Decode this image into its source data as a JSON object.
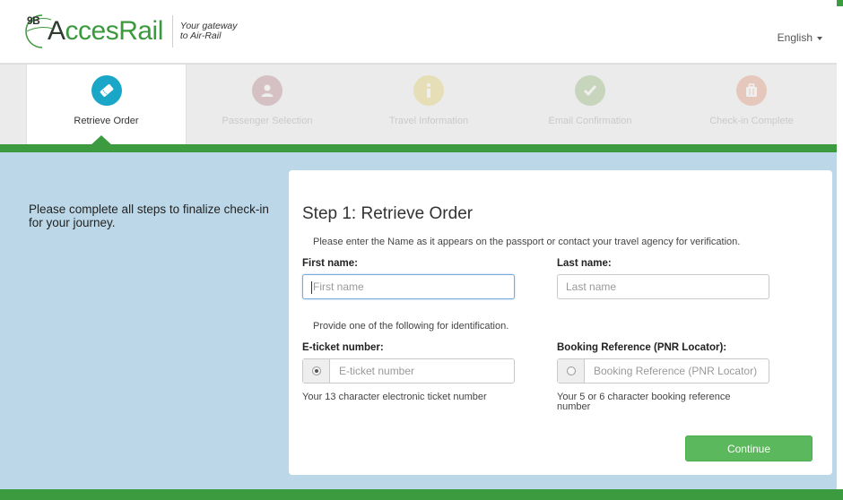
{
  "header": {
    "logo_code": "9B",
    "logo_text_first": "A",
    "logo_text_rest": "ccesRail",
    "tagline_line1": "Your gateway",
    "tagline_line2": "to Air-Rail",
    "language": "English"
  },
  "steps": [
    {
      "label": "Retrieve Order",
      "icon": "ticket-icon",
      "color": "#1aa6c7",
      "active": true
    },
    {
      "label": "Passenger Selection",
      "icon": "person-icon",
      "color": "#8a2d3c",
      "active": false
    },
    {
      "label": "Travel Information",
      "icon": "info-icon",
      "color": "#d8b400",
      "active": false
    },
    {
      "label": "Email Confirmation",
      "icon": "checkmark-icon",
      "color": "#4e8a20",
      "active": false
    },
    {
      "label": "Check-in Complete",
      "icon": "luggage-icon",
      "color": "#d84b16",
      "active": false
    }
  ],
  "intro": "Please complete all steps to finalize check-in for your journey.",
  "form": {
    "title": "Step 1: Retrieve Order",
    "name_hint": "Please enter the Name as it appears on the passport or contact your travel agency for verification.",
    "first_name_label": "First name:",
    "first_name_placeholder": "First name",
    "last_name_label": "Last name:",
    "last_name_placeholder": "Last name",
    "id_hint": "Provide one of the following for identification.",
    "eticket_label": "E-ticket number:",
    "eticket_placeholder": "E-ticket number",
    "eticket_helper": "Your 13 character electronic ticket number",
    "pnr_label": "Booking Reference (PNR Locator):",
    "pnr_placeholder": "Booking Reference (PNR Locator)",
    "pnr_helper": "Your 5 or 6 character booking reference number",
    "continue_label": "Continue"
  },
  "colors": {
    "brand_green": "#3d9b3f",
    "main_background": "#bcd8e8",
    "continue_button": "#5cb85c"
  }
}
